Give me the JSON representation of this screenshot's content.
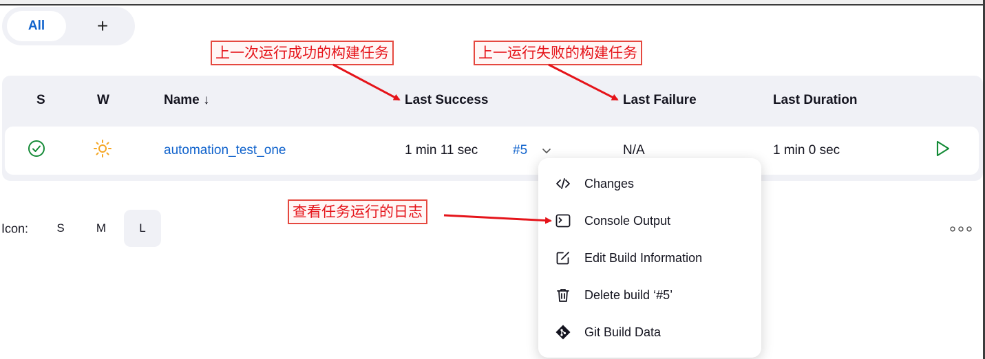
{
  "tabs": {
    "all_label": "All",
    "add_label": "+"
  },
  "table": {
    "headers": {
      "status": "S",
      "weather": "W",
      "name": "Name ↓",
      "last_success": "Last Success",
      "last_failure": "Last Failure",
      "last_duration": "Last Duration"
    },
    "rows": [
      {
        "status_icon": "success-check-icon",
        "weather_icon": "sunny-icon",
        "name": "automation_test_one",
        "last_success": "1 min 11 sec",
        "build": "#5",
        "last_failure": "N/A",
        "last_duration": "1 min 0 sec"
      }
    ]
  },
  "icon_size": {
    "label": "Icon:",
    "options": [
      "S",
      "M",
      "L"
    ],
    "selected": "L"
  },
  "build_menu": {
    "items": [
      {
        "icon": "code-icon",
        "label": "Changes"
      },
      {
        "icon": "terminal-icon",
        "label": "Console Output"
      },
      {
        "icon": "edit-icon",
        "label": "Edit Build Information"
      },
      {
        "icon": "trash-icon",
        "label": "Delete build ‘#5’"
      },
      {
        "icon": "git-icon",
        "label": "Git Build Data"
      }
    ]
  },
  "annotations": {
    "last_success_note": "上一次运行成功的构建任务",
    "last_failure_note": "上一运行失败的构建任务",
    "console_note": "查看任务运行的日志"
  },
  "colors": {
    "accent": "#0f62cc",
    "success": "#138a36",
    "weather": "#f5a623",
    "annotation": "#e5141a"
  }
}
